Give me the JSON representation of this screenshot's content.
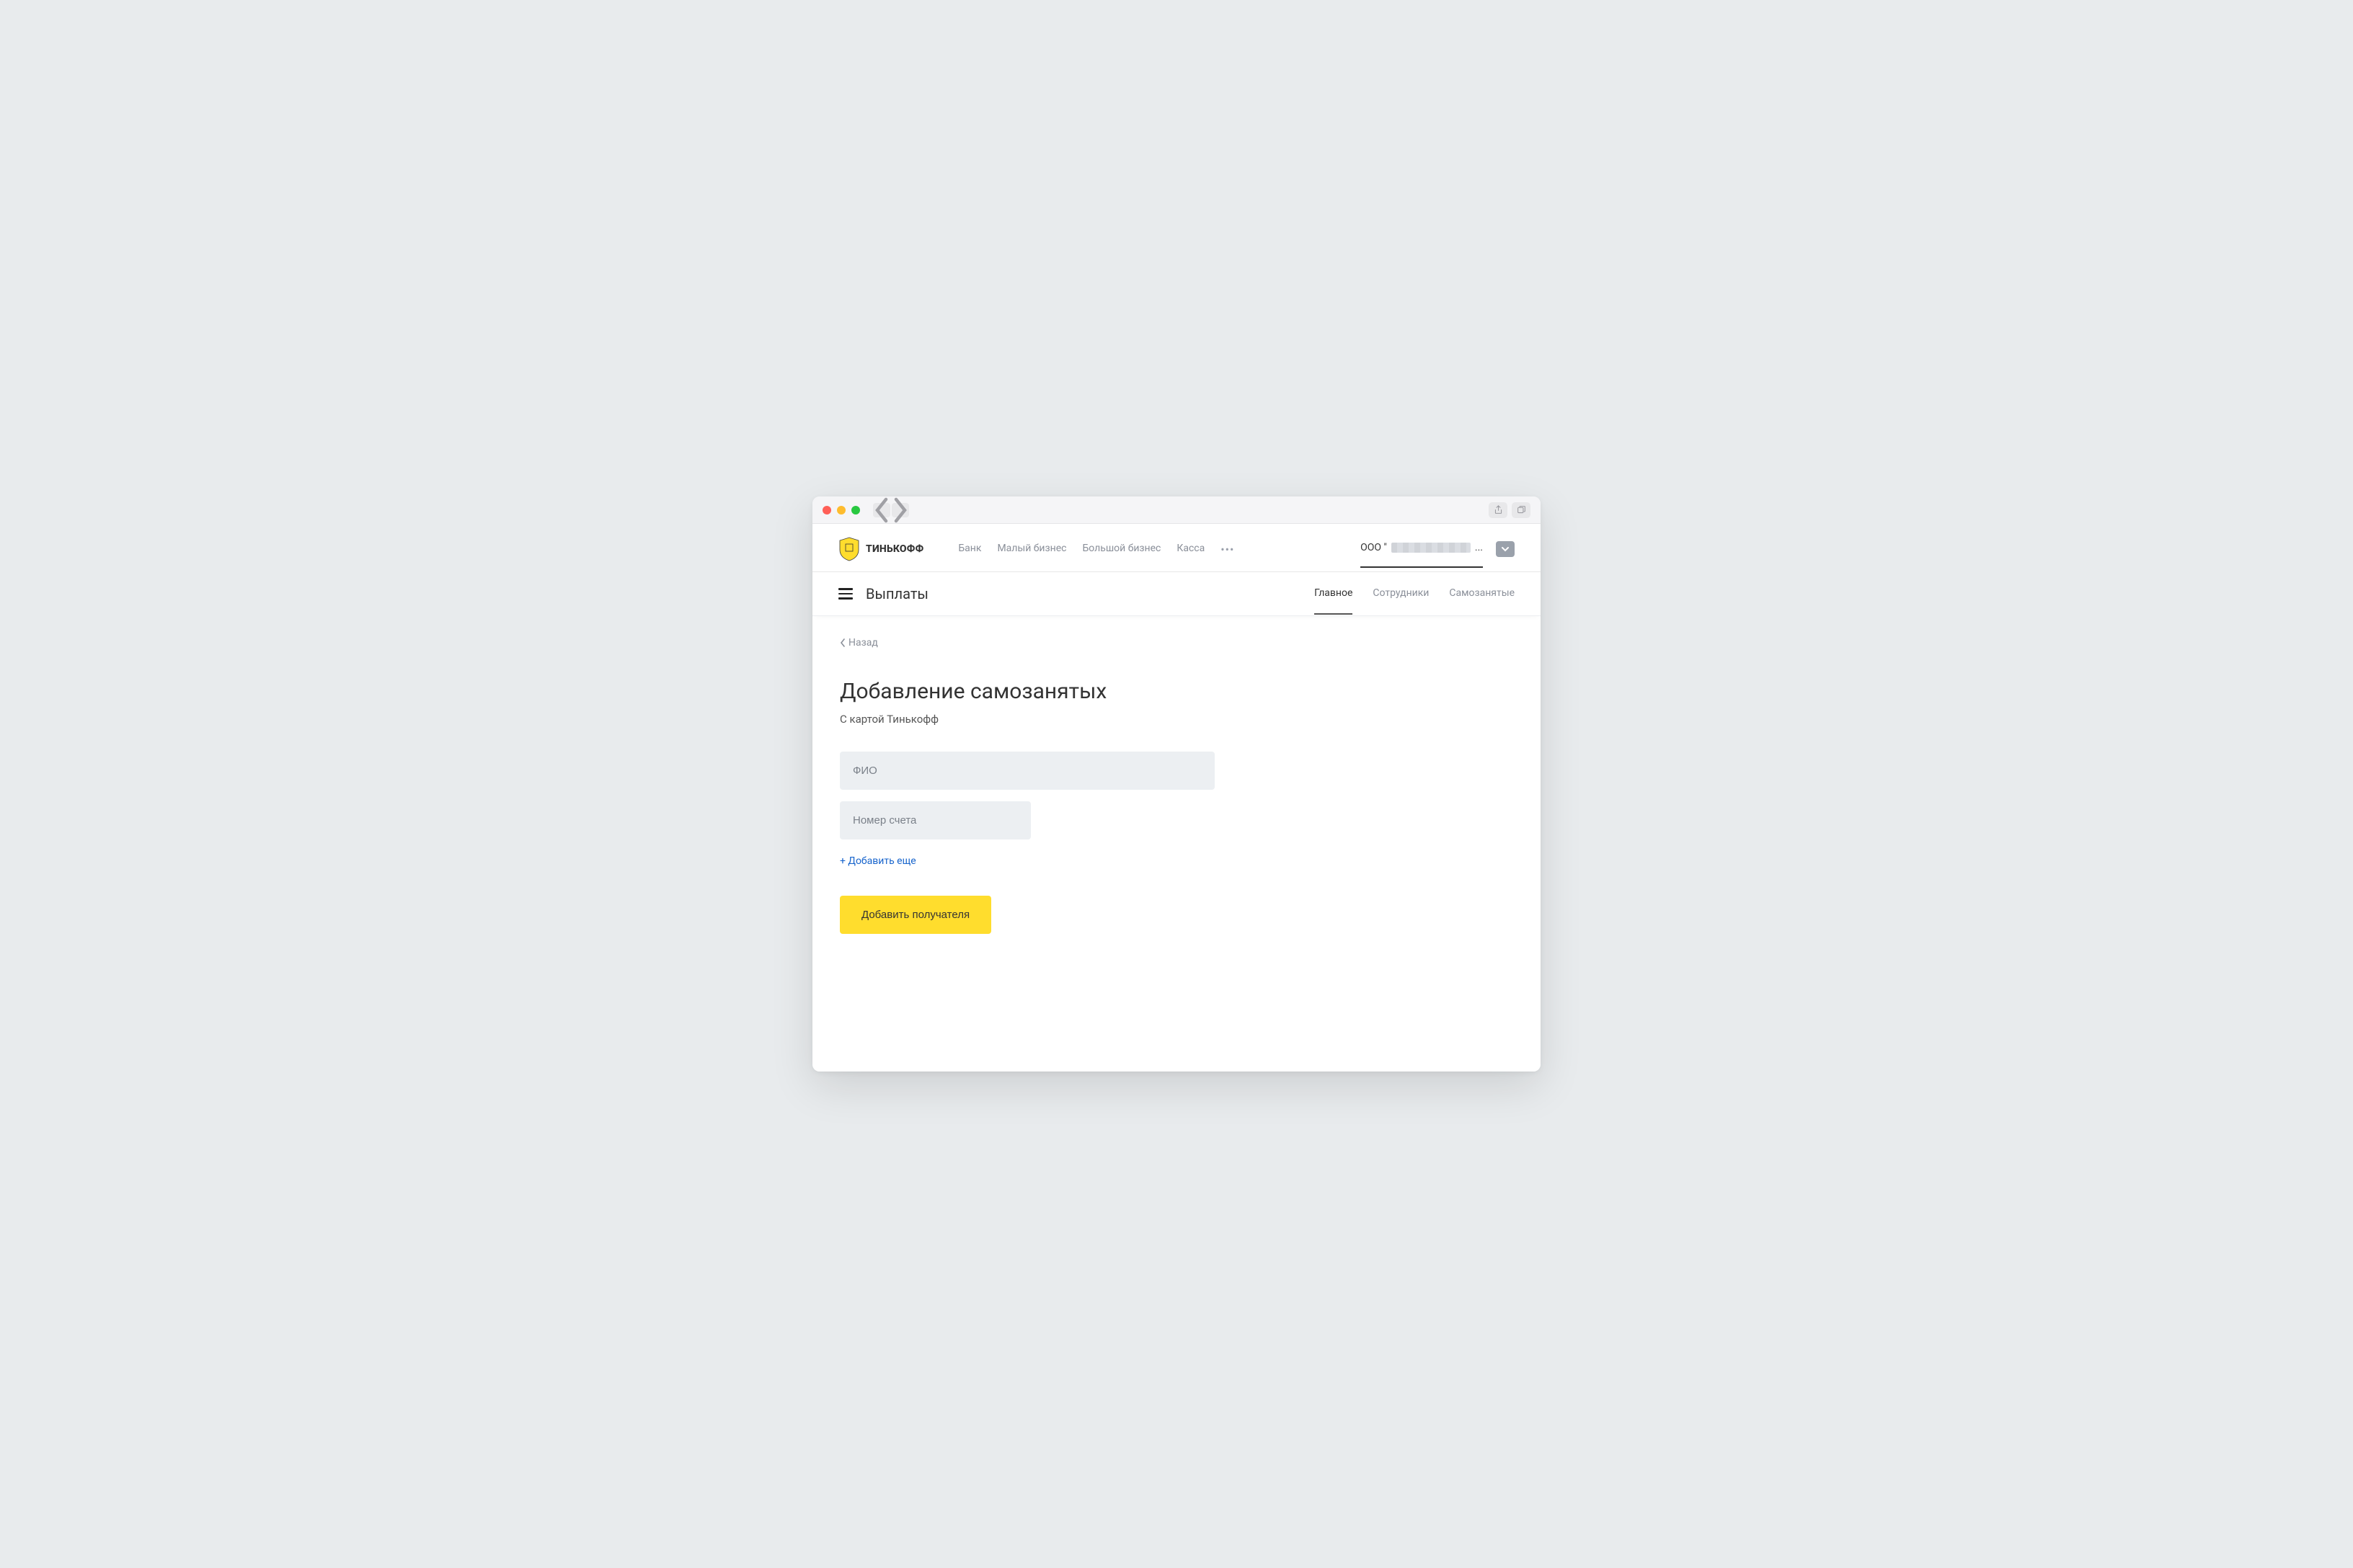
{
  "brand": {
    "name": "ТИНЬКОФФ"
  },
  "topnav": {
    "items": [
      "Банк",
      "Малый бизнес",
      "Большой бизнес",
      "Касса"
    ]
  },
  "account": {
    "prefix": "ООО \"",
    "suffix": "..."
  },
  "subbar": {
    "title": "Выплаты",
    "tabs": [
      {
        "label": "Главное",
        "active": true
      },
      {
        "label": "Сотрудники",
        "active": false
      },
      {
        "label": "Самозанятые",
        "active": false
      }
    ]
  },
  "back": {
    "label": "Назад"
  },
  "page": {
    "title": "Добавление самозанятых",
    "subtitle": "С картой Тинькофф"
  },
  "form": {
    "fio_placeholder": "ФИО",
    "account_placeholder": "Номер счета",
    "add_more": "+ Добавить еще",
    "submit": "Добавить получателя"
  },
  "colors": {
    "accent": "#ffdd2d",
    "link": "#1764cc"
  }
}
